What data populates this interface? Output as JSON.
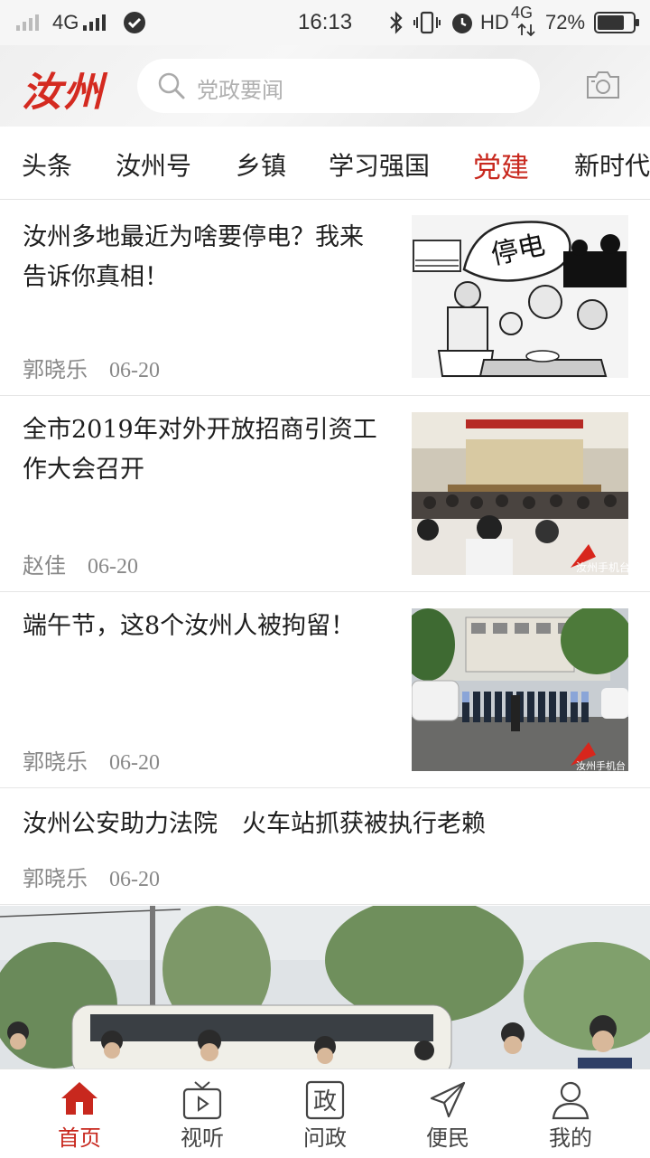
{
  "status_bar": {
    "network": "4G",
    "time": "16:13",
    "hd": "HD",
    "network2": "4G",
    "battery": "72%"
  },
  "header": {
    "logo": "汝州",
    "search_placeholder": "党政要闻"
  },
  "tabs": [
    {
      "label": "头条"
    },
    {
      "label": "汝州号"
    },
    {
      "label": "乡镇"
    },
    {
      "label": "学习强国"
    },
    {
      "label": "党建",
      "active": true
    },
    {
      "label": "新时代"
    }
  ],
  "articles": [
    {
      "title_line1": "汝州多地最近为啥要停电？我来",
      "title_line2": "告诉你真相！",
      "author": "郭晓乐",
      "date": "06-20",
      "thumb_text": "停电"
    },
    {
      "title_line1": "全市2019年对外开放招商引资工",
      "title_line2": "作大会召开",
      "author": "赵佳",
      "date": "06-20",
      "watermark": "汝州手机台"
    },
    {
      "title_line1": "端午节，这8个汝州人被拘留！",
      "title_line2": "",
      "author": "郭晓乐",
      "date": "06-20",
      "watermark": "汝州手机台"
    },
    {
      "title_line1": "汝州公安助力法院　火车站抓获被执行老赖",
      "title_line2": "",
      "author": "郭晓乐",
      "date": "06-20"
    }
  ],
  "bottom_nav": [
    {
      "label": "首页",
      "icon": "home-icon",
      "active": true
    },
    {
      "label": "视听",
      "icon": "tv-icon"
    },
    {
      "label": "问政",
      "icon": "zheng-icon",
      "glyph": "政"
    },
    {
      "label": "便民",
      "icon": "paper-plane-icon"
    },
    {
      "label": "我的",
      "icon": "user-icon"
    }
  ],
  "colors": {
    "accent": "#c8281e",
    "logo": "#d42a20"
  }
}
